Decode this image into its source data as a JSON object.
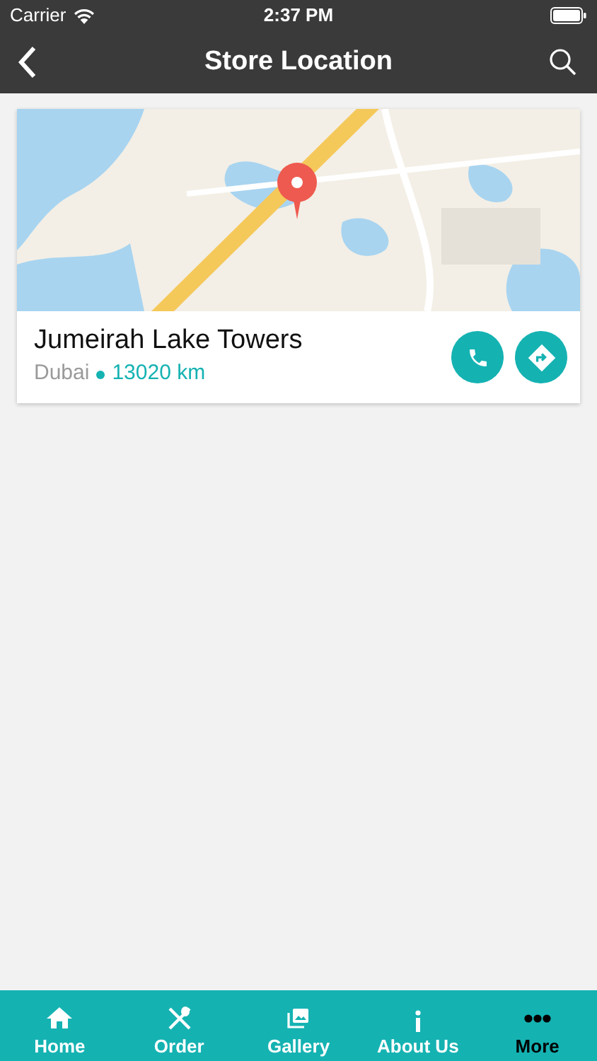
{
  "status_bar": {
    "carrier": "Carrier",
    "time": "2:37 PM"
  },
  "nav_bar": {
    "title": "Store Location"
  },
  "stores": [
    {
      "name": "Jumeirah Lake Towers",
      "city": "Dubai",
      "distance": "13020 km"
    }
  ],
  "tab_bar": [
    {
      "label": "Home",
      "kind": "home",
      "selected": false
    },
    {
      "label": "Order",
      "kind": "order",
      "selected": false
    },
    {
      "label": "Gallery",
      "kind": "gallery",
      "selected": false
    },
    {
      "label": "About Us",
      "kind": "info",
      "selected": false
    },
    {
      "label": "More",
      "kind": "more",
      "selected": true
    }
  ]
}
